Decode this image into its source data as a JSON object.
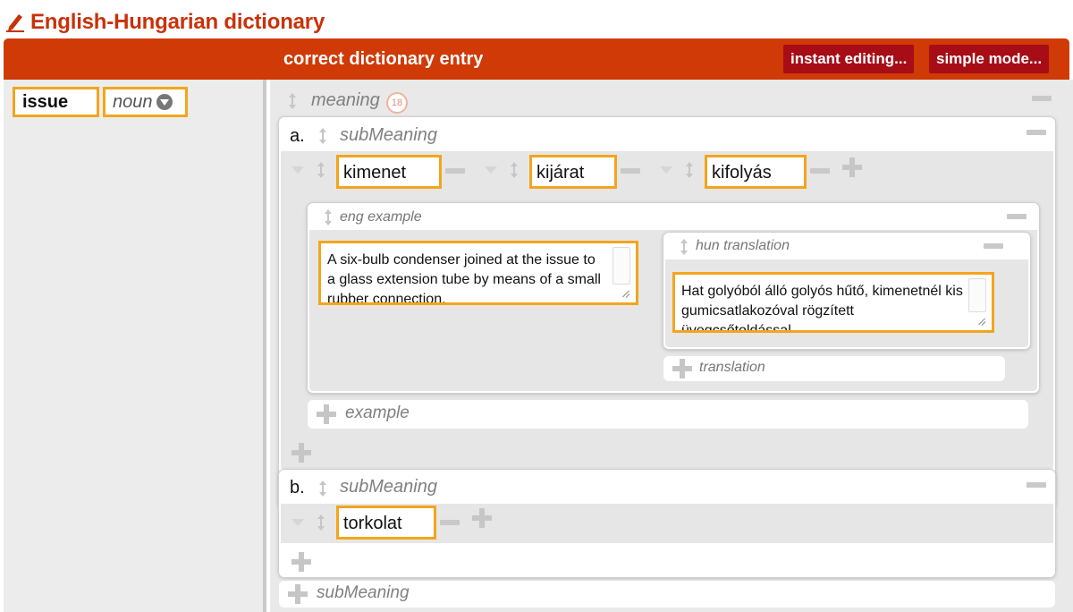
{
  "app": {
    "title": "English-Hungarian dictionary"
  },
  "header": {
    "title": "correct dictionary entry",
    "instant_editing_label": "instant editing...",
    "simple_mode_label": "simple mode..."
  },
  "entry": {
    "headword": "issue",
    "part_of_speech": "noun"
  },
  "meaning": {
    "label": "meaning",
    "count": "18",
    "submeanings": [
      {
        "letter": "a.",
        "label": "subMeaning",
        "words": [
          "kimenet",
          "kijárat",
          "kifolyás"
        ],
        "example": {
          "eng_label": "eng example",
          "eng_text": "A six-bulb condenser joined at the issue to a glass extension tube by means of a small rubber connection.",
          "hun_label": "hun translation",
          "hun_text": "Hat golyóból álló golyós hűtő, kimenetnél kis gumicsatlakozóval rögzített üvegcsőtoldással.",
          "add_translation_label": "translation"
        },
        "add_example_label": "example"
      },
      {
        "letter": "b.",
        "label": "subMeaning",
        "words": [
          "torkolat"
        ]
      }
    ],
    "add_submeaning_label": "subMeaning"
  },
  "colors": {
    "header_red": "#cf3a06",
    "button_dark_red": "#a60d16",
    "highlight_orange": "#f3a51c",
    "title_red": "#c8320a"
  }
}
